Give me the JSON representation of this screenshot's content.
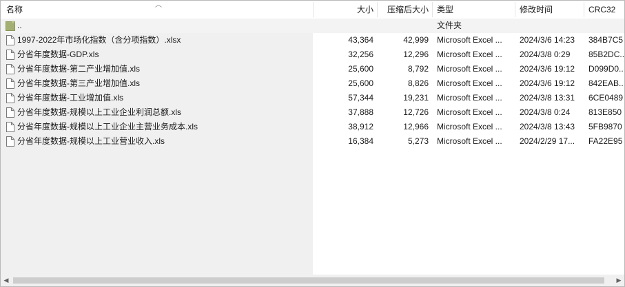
{
  "columns": {
    "name": "名称",
    "size": "大小",
    "packed": "压缩后大小",
    "type": "类型",
    "modified": "修改时间",
    "crc": "CRC32"
  },
  "parent_row": {
    "name": "..",
    "type": "文件夹"
  },
  "files": [
    {
      "name": "1997-2022年市场化指数（含分项指数）.xlsx",
      "size": "43,364",
      "packed": "42,999",
      "type": "Microsoft Excel ...",
      "modified": "2024/3/6 14:23",
      "crc": "384B7C5"
    },
    {
      "name": "分省年度数据-GDP.xls",
      "size": "32,256",
      "packed": "12,296",
      "type": "Microsoft Excel ...",
      "modified": "2024/3/8 0:29",
      "crc": "85B2DC..."
    },
    {
      "name": "分省年度数据-第二产业增加值.xls",
      "size": "25,600",
      "packed": "8,792",
      "type": "Microsoft Excel ...",
      "modified": "2024/3/6 19:12",
      "crc": "D099D0..."
    },
    {
      "name": "分省年度数据-第三产业增加值.xls",
      "size": "25,600",
      "packed": "8,826",
      "type": "Microsoft Excel ...",
      "modified": "2024/3/6 19:12",
      "crc": "842EAB..."
    },
    {
      "name": "分省年度数据-工业增加值.xls",
      "size": "57,344",
      "packed": "19,231",
      "type": "Microsoft Excel ...",
      "modified": "2024/3/8 13:31",
      "crc": "6CE0489"
    },
    {
      "name": "分省年度数据-规模以上工业企业利润总额.xls",
      "size": "37,888",
      "packed": "12,726",
      "type": "Microsoft Excel ...",
      "modified": "2024/3/8 0:24",
      "crc": "813E850"
    },
    {
      "name": "分省年度数据-规模以上工业企业主营业务成本.xls",
      "size": "38,912",
      "packed": "12,966",
      "type": "Microsoft Excel ...",
      "modified": "2024/3/8 13:43",
      "crc": "5FB9870"
    },
    {
      "name": "分省年度数据-规模以上工业营业收入.xls",
      "size": "16,384",
      "packed": "5,273",
      "type": "Microsoft Excel ...",
      "modified": "2024/2/29 17...",
      "crc": "FA22E95"
    }
  ],
  "icons": {
    "file": "document-icon",
    "folder": "folder-icon"
  },
  "colors": {
    "name_pane_bg": "#f0f0f0",
    "folder": "#a3b072",
    "border": "#b9b9b9"
  }
}
